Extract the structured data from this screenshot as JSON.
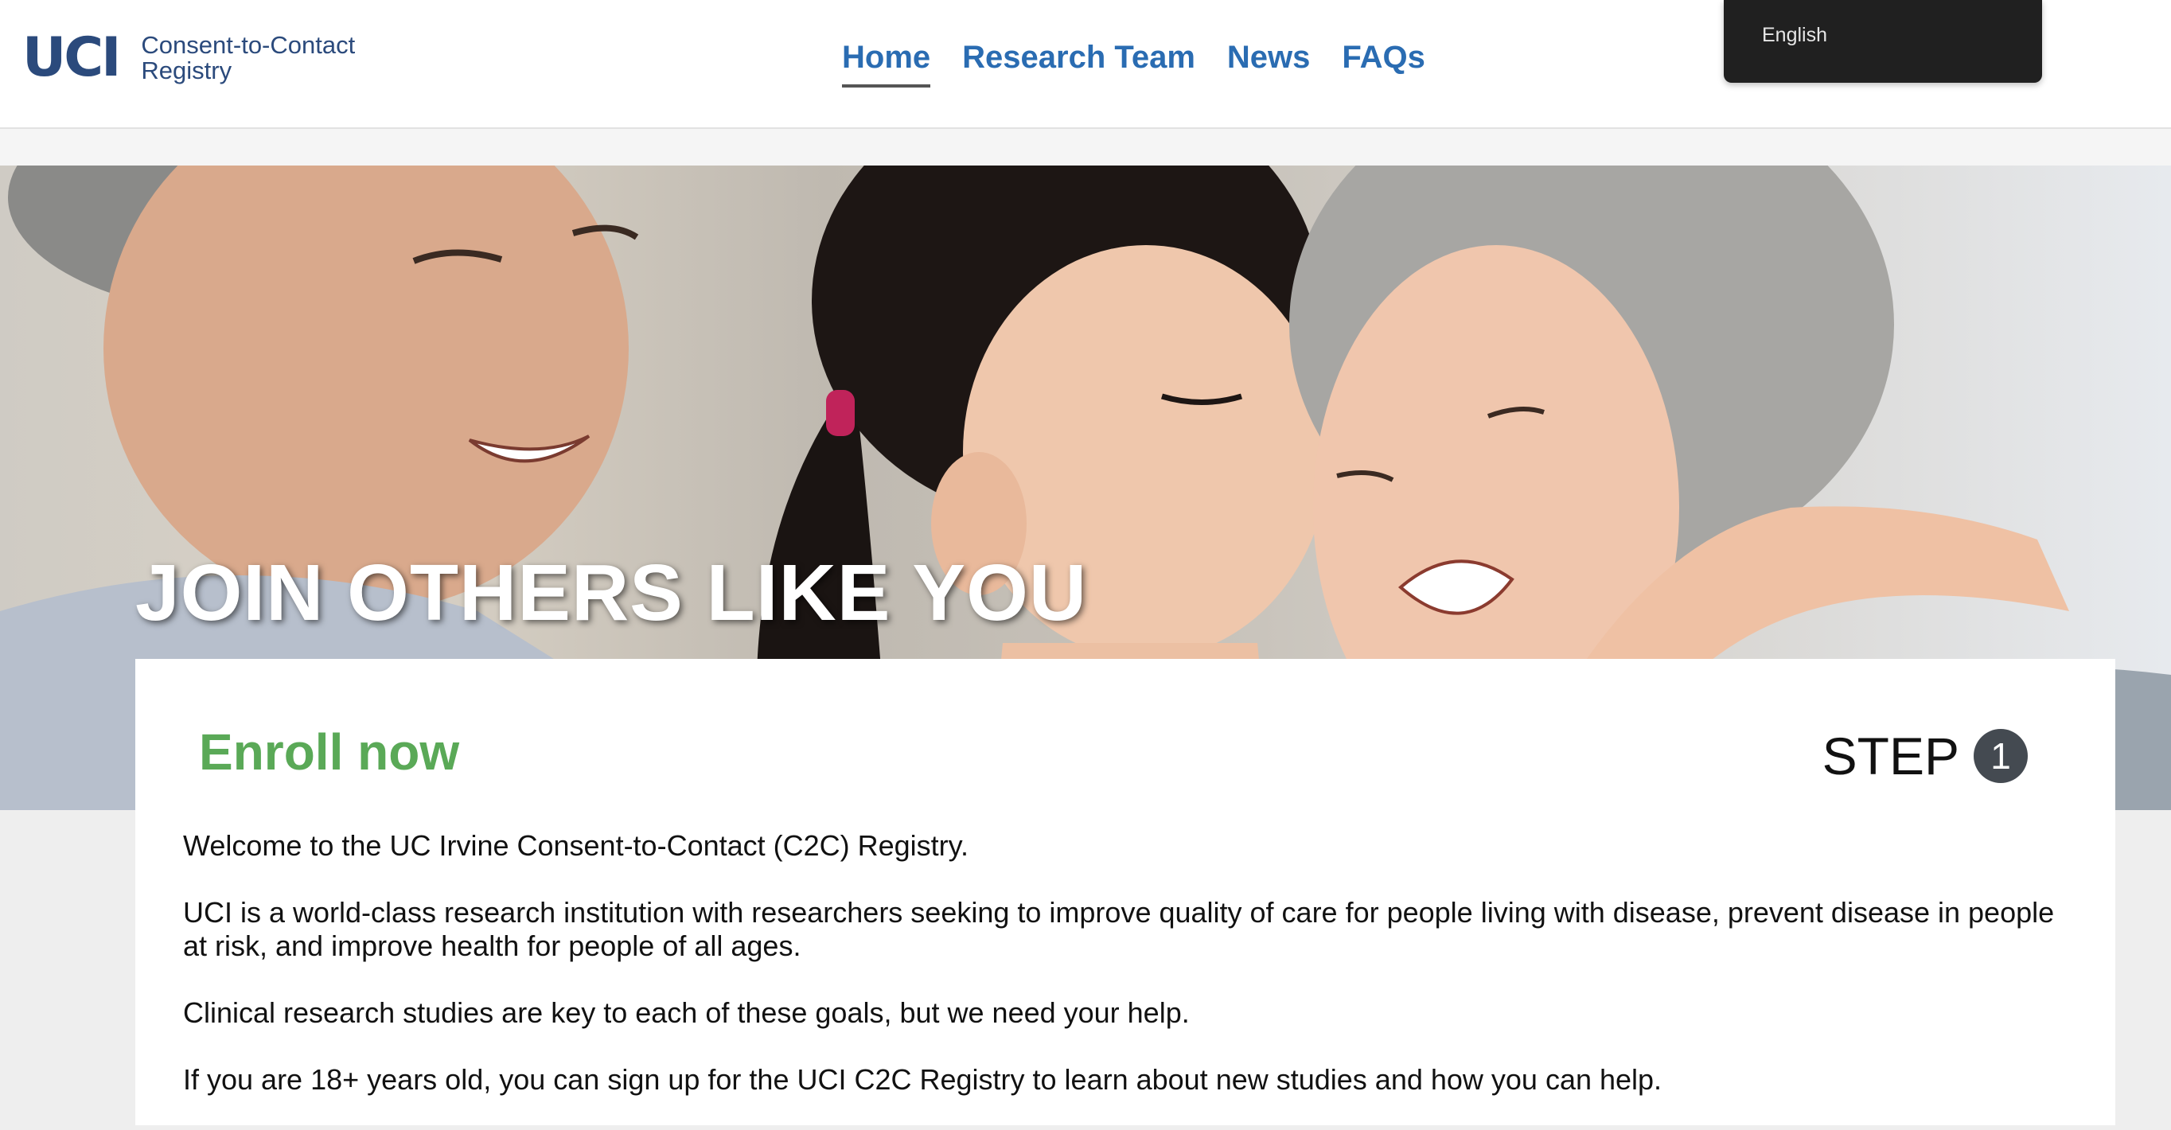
{
  "header": {
    "logo_mark": "UCI",
    "logo_line1": "Consent-to-Contact",
    "logo_line2": "Registry",
    "nav": [
      {
        "label": "Home",
        "active": true
      },
      {
        "label": "Research Team",
        "active": false
      },
      {
        "label": "News",
        "active": false
      },
      {
        "label": "FAQs",
        "active": false
      }
    ],
    "language": "English"
  },
  "hero": {
    "title": "JOIN OTHERS LIKE YOU"
  },
  "card": {
    "enroll_title": "Enroll now",
    "step_label": "STEP",
    "step_number": "1",
    "paragraphs": [
      "Welcome to the UC Irvine Consent-to-Contact (C2C) Registry.",
      "UCI is a world-class research institution with researchers seeking to improve quality of care for people living with disease, prevent disease in people at risk, and improve health for people of all ages.",
      "Clinical research studies are key to each of these goals, but we need your help.",
      "If you are 18+ years old, you can sign up for the UCI C2C Registry to learn about new studies and how you can help."
    ]
  },
  "colors": {
    "brand_blue": "#2b4a7c",
    "nav_blue": "#2a6cb2",
    "enroll_green": "#5aa957",
    "lang_bg": "#202020"
  }
}
